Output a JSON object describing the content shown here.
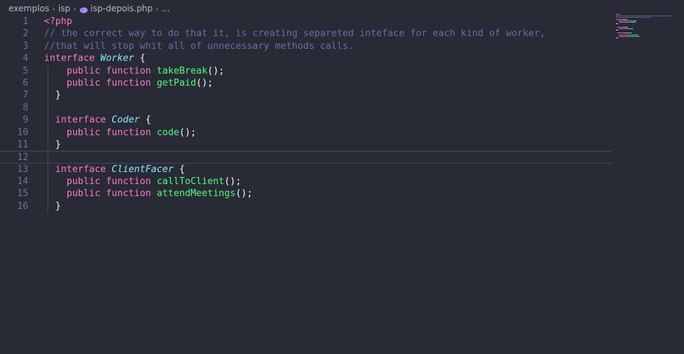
{
  "breadcrumb": {
    "folder1": "exemplos",
    "folder2": "isp",
    "file": "isp-depois.php",
    "more": "..."
  },
  "editor": {
    "lines": [
      {
        "num": "1",
        "tokens": [
          {
            "t": "<?php",
            "c": "k-tag"
          }
        ]
      },
      {
        "num": "2",
        "tokens": [
          {
            "t": "// the correct way to do that it, is creating separeted inteface for each kind of worker,",
            "c": "k-comment"
          }
        ]
      },
      {
        "num": "3",
        "tokens": [
          {
            "t": "//that will stop whit all of unnecessary methods calls.",
            "c": "k-comment"
          }
        ]
      },
      {
        "num": "4",
        "tokens": [
          {
            "t": "interface ",
            "c": "k-kw"
          },
          {
            "t": "Worker",
            "c": "k-type"
          },
          {
            "t": " {",
            "c": "k-punc"
          }
        ]
      },
      {
        "num": "5",
        "tokens": [
          {
            "t": "    ",
            "c": "k-punc"
          },
          {
            "t": "public function ",
            "c": "k-kw"
          },
          {
            "t": "takeBreak",
            "c": "k-fn"
          },
          {
            "t": "();",
            "c": "k-punc"
          }
        ]
      },
      {
        "num": "6",
        "tokens": [
          {
            "t": "    ",
            "c": "k-punc"
          },
          {
            "t": "public function ",
            "c": "k-kw"
          },
          {
            "t": "getPaid",
            "c": "k-fn"
          },
          {
            "t": "();",
            "c": "k-punc"
          }
        ]
      },
      {
        "num": "7",
        "tokens": [
          {
            "t": "  }",
            "c": "k-punc"
          }
        ]
      },
      {
        "num": "8",
        "tokens": []
      },
      {
        "num": "9",
        "tokens": [
          {
            "t": "  ",
            "c": "k-punc"
          },
          {
            "t": "interface ",
            "c": "k-kw"
          },
          {
            "t": "Coder",
            "c": "k-type"
          },
          {
            "t": " {",
            "c": "k-punc"
          }
        ]
      },
      {
        "num": "10",
        "tokens": [
          {
            "t": "    ",
            "c": "k-punc"
          },
          {
            "t": "public function ",
            "c": "k-kw"
          },
          {
            "t": "code",
            "c": "k-fn"
          },
          {
            "t": "();",
            "c": "k-punc"
          }
        ]
      },
      {
        "num": "11",
        "tokens": [
          {
            "t": "  }",
            "c": "k-punc"
          }
        ]
      },
      {
        "num": "12",
        "tokens": []
      },
      {
        "num": "13",
        "tokens": [
          {
            "t": "  ",
            "c": "k-punc"
          },
          {
            "t": "interface ",
            "c": "k-kw"
          },
          {
            "t": "ClientFacer",
            "c": "k-type"
          },
          {
            "t": " {",
            "c": "k-punc"
          }
        ]
      },
      {
        "num": "14",
        "tokens": [
          {
            "t": "    ",
            "c": "k-punc"
          },
          {
            "t": "public function ",
            "c": "k-kw"
          },
          {
            "t": "callToClient",
            "c": "k-fn"
          },
          {
            "t": "();",
            "c": "k-punc"
          }
        ]
      },
      {
        "num": "15",
        "tokens": [
          {
            "t": "    ",
            "c": "k-punc"
          },
          {
            "t": "public function ",
            "c": "k-kw"
          },
          {
            "t": "attendMeetings",
            "c": "k-fn"
          },
          {
            "t": "();",
            "c": "k-punc"
          }
        ]
      },
      {
        "num": "16",
        "tokens": [
          {
            "t": "  }",
            "c": "k-punc"
          }
        ]
      }
    ],
    "current_line": "12"
  },
  "colors": {
    "background": "#282a36",
    "keyword": "#ff79c6",
    "comment": "#6272a4",
    "type": "#8be9fd",
    "function": "#50fa7b",
    "text": "#f8f8f2"
  },
  "icons": {
    "php_file": "php-elephant-icon",
    "chevron": "chevron-right-icon"
  }
}
